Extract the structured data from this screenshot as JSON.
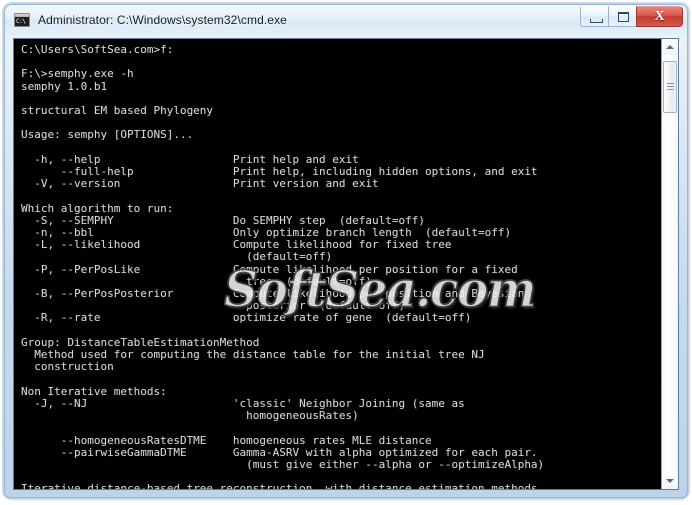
{
  "window": {
    "title": "Administrator: C:\\Windows\\system32\\cmd.exe",
    "icon_name": "cmd-console-icon",
    "controls": {
      "minimize_label": "–",
      "maximize_label": "□",
      "close_label": "X"
    }
  },
  "watermark": {
    "text": "SoftSea.com"
  },
  "scrollbar": {
    "up_arrow": "▲",
    "down_arrow": "▼"
  },
  "console": {
    "prompt_line": "C:\\Users\\SoftSea.com>f:",
    "command_line": "F:\\>semphy.exe -h",
    "program_version": "semphy 1.0.b1",
    "program_description": "structural EM based Phylogeny",
    "usage_line": "Usage: semphy [OPTIONS]...",
    "text": "C:\\Users\\SoftSea.com>f:\n\nF:\\>semphy.exe -h\nsemphy 1.0.b1\n\nstructural EM based Phylogeny\n\nUsage: semphy [OPTIONS]...\n\n  -h, --help                    Print help and exit\n      --full-help               Print help, including hidden options, and exit\n  -V, --version                 Print version and exit\n\nWhich algorithm to run:\n  -S, --SEMPHY                  Do SEMPHY step  (default=off)\n  -n, --bbl                     Only optimize branch length  (default=off)\n  -L, --likelihood              Compute likelihood for fixed tree\n                                  (default=off)\n  -P, --PerPosLike              Compute likelihood per position for a fixed\n                                  tree  (default=off)\n  -B, --PerPosPosterior         Compute likelihood per position and Bayesian\n                                  posterior  (default=off)\n  -R, --rate                    optimize rate of gene  (default=off)\n\nGroup: DistanceTableEstimationMethod\n  Method used for computing the distance table for the initial tree NJ\n  construction\n\nNon Iterative methods:\n  -J, --NJ                      'classic' Neighbor Joining (same as\n                                  homogeneousRates)\n\n      --homogeneousRatesDTME    homogeneous rates MLE distance\n      --pairwiseGammaDTME       Gamma-ASRV with alpha optimized for each pair.\n                                  (must give either --alpha or --optimizeAlpha)\n\nIterative distance-based tree reconstruction, with distance estimation methods",
    "colors": {
      "background": "#000000",
      "foreground": "#d8d8d8"
    }
  }
}
